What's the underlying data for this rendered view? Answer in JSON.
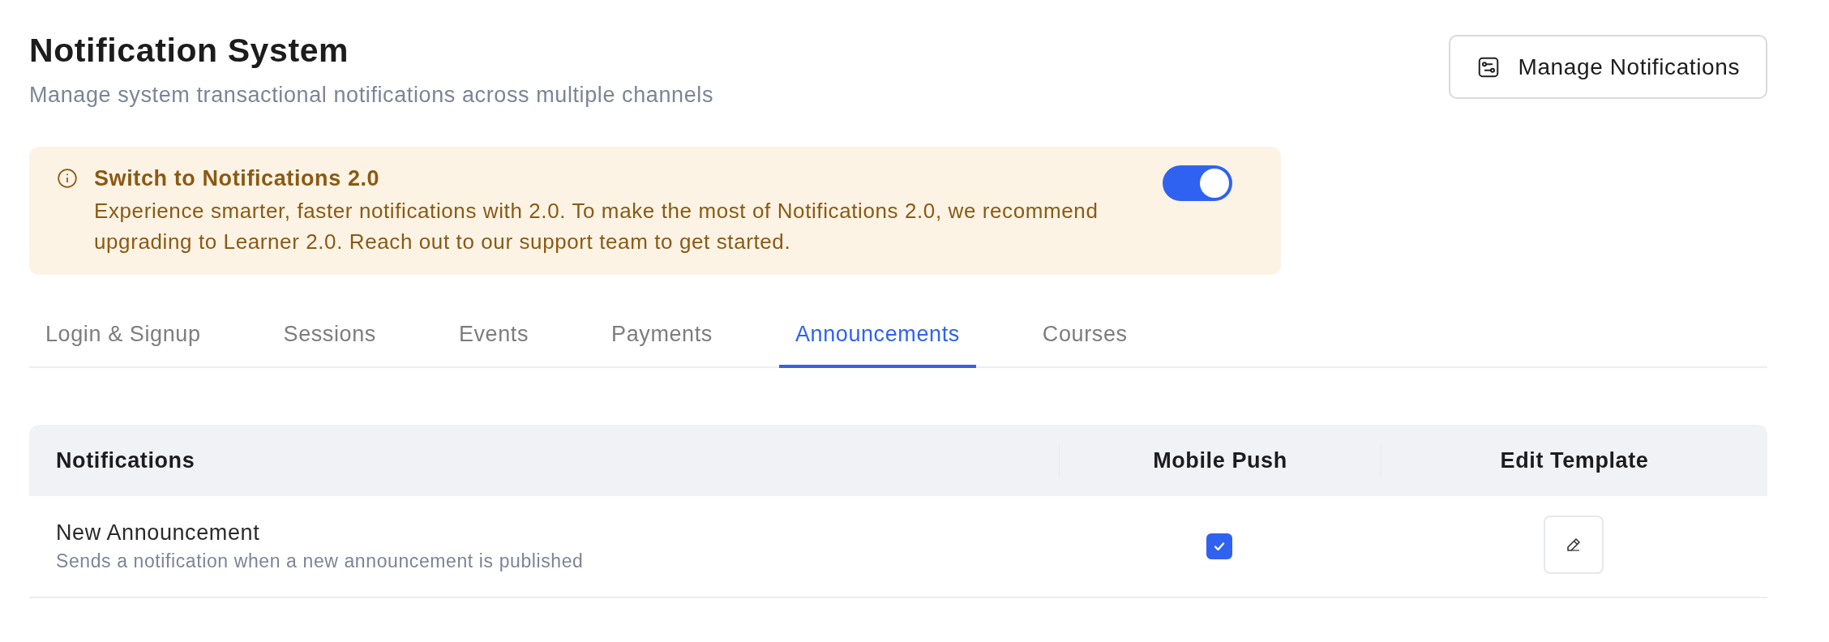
{
  "header": {
    "title": "Notification System",
    "subtitle": "Manage system transactional notifications across multiple channels",
    "manage_button": "Manage Notifications"
  },
  "banner": {
    "title": "Switch to Notifications 2.0",
    "body": "Experience smarter, faster notifications with 2.0. To make the most of Notifications 2.0, we recommend upgrading to Learner 2.0. Reach out to our support team to get started.",
    "toggle_on": true
  },
  "tabs": [
    {
      "label": "Login & Signup",
      "selected": false
    },
    {
      "label": "Sessions",
      "selected": false
    },
    {
      "label": "Events",
      "selected": false
    },
    {
      "label": "Payments",
      "selected": false
    },
    {
      "label": "Announcements",
      "selected": true
    },
    {
      "label": "Courses",
      "selected": false
    }
  ],
  "table": {
    "columns": [
      "Notifications",
      "Mobile Push",
      "Edit Template"
    ],
    "rows": [
      {
        "title": "New Announcement",
        "description": "Sends a notification when a new announcement is published",
        "mobile_push": true
      }
    ]
  }
}
